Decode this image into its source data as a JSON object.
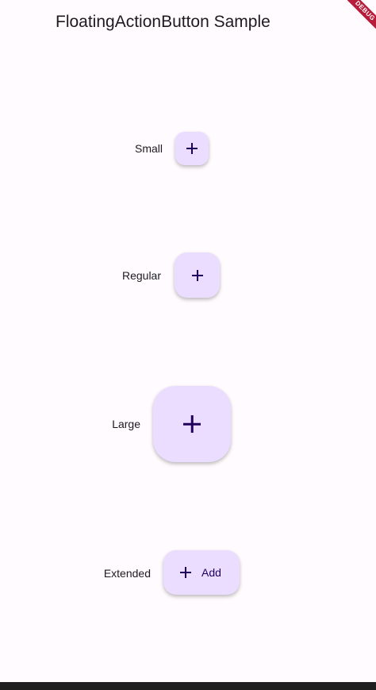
{
  "app_bar": {
    "title": "FloatingActionButton Sample"
  },
  "debug_banner": {
    "label": "DEBUG"
  },
  "rows": {
    "small": {
      "label": "Small",
      "icon": "add-icon"
    },
    "regular": {
      "label": "Regular",
      "icon": "add-icon"
    },
    "large": {
      "label": "Large",
      "icon": "add-icon"
    },
    "extended": {
      "label": "Extended",
      "icon": "add-icon",
      "button_label": "Add"
    }
  },
  "colors": {
    "background": "#fffbfe",
    "fab_container": "#eaddff",
    "fab_content": "#21005d",
    "text": "#1c1b1f",
    "debug_banner": "#b71c3a"
  }
}
